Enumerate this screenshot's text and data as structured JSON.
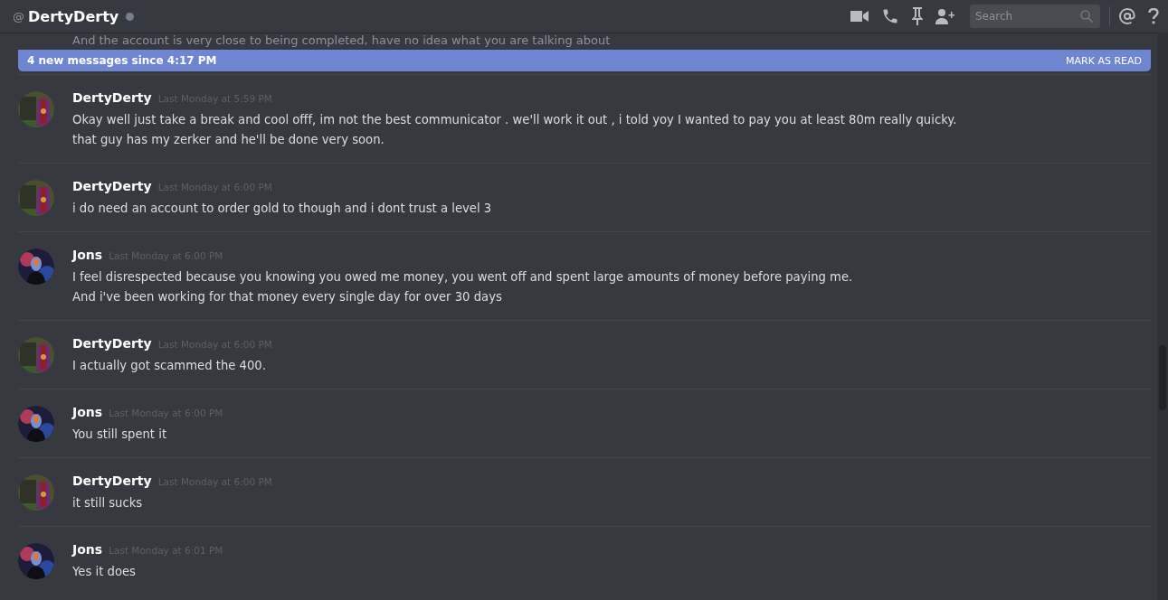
{
  "header": {
    "at_symbol": "@",
    "title": "DertyDerty",
    "search": {
      "placeholder": "Search"
    }
  },
  "partial_message": "And the account is very close to being completed, have no idea what you are talking about",
  "new_messages_bar": {
    "text": "4 new messages since 4:17 PM",
    "action": "MARK AS READ"
  },
  "messages": [
    {
      "author": "DertyDerty",
      "avatar": {
        "kind": "picture"
      },
      "timestamp": "Last Monday at 5:59 PM",
      "lines": [
        "Okay well just take a break and cool offf, im not the best communicator . we'll work it out , i told yoy I wanted to pay you at least 80m really quicky.",
        "that guy has my zerker and he'll be done very soon."
      ]
    },
    {
      "author": "DertyDerty",
      "avatar": {
        "kind": "picture"
      },
      "timestamp": "Last Monday at 6:00 PM",
      "lines": [
        "i do need an account to order gold to though and i dont trust a level 3"
      ]
    },
    {
      "author": "Jons",
      "avatar": {
        "kind": "picture"
      },
      "timestamp": "Last Monday at 6:00 PM",
      "lines": [
        "I feel disrespected because you knowing you owed me money, you went off and spent large amounts of money before paying me.",
        "And i've been working for that money every single day for over 30 days"
      ]
    },
    {
      "author": "DertyDerty",
      "avatar": {
        "kind": "picture"
      },
      "timestamp": "Last Monday at 6:00 PM",
      "lines": [
        "I actually got scammed the 400."
      ]
    },
    {
      "author": "Jons",
      "avatar": {
        "kind": "picture"
      },
      "timestamp": "Last Monday at 6:00 PM",
      "lines": [
        "You still spent it"
      ]
    },
    {
      "author": "DertyDerty",
      "avatar": {
        "kind": "picture"
      },
      "timestamp": "Last Monday at 6:00 PM",
      "lines": [
        "it still sucks"
      ]
    },
    {
      "author": "Jons",
      "avatar": {
        "kind": "picture"
      },
      "timestamp": "Last Monday at 6:01 PM",
      "lines": [
        "Yes it does"
      ]
    }
  ]
}
